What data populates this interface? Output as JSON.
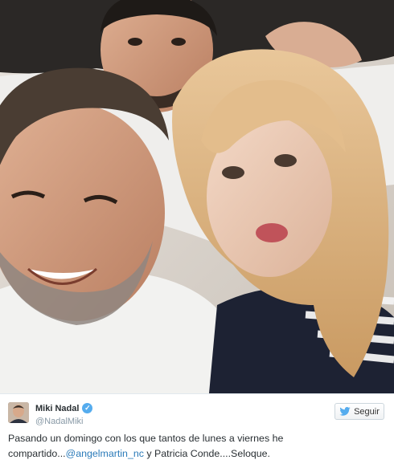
{
  "tweet": {
    "author_name": "Miki Nadal",
    "author_handle": "@NadalMiki",
    "follow_label": "Seguir",
    "text_part1": "Pasando un domingo con los que tantos de lunes a viernes he compartido...",
    "mention": "@angelmartin_nc",
    "text_part2": " y Patricia Conde....Seloque."
  },
  "icons": {
    "verified": "verified-badge-icon",
    "follow": "twitter-bird-icon"
  },
  "colors": {
    "link": "#2b7bb9",
    "verified": "#55acee",
    "handle": "#8899a6"
  }
}
